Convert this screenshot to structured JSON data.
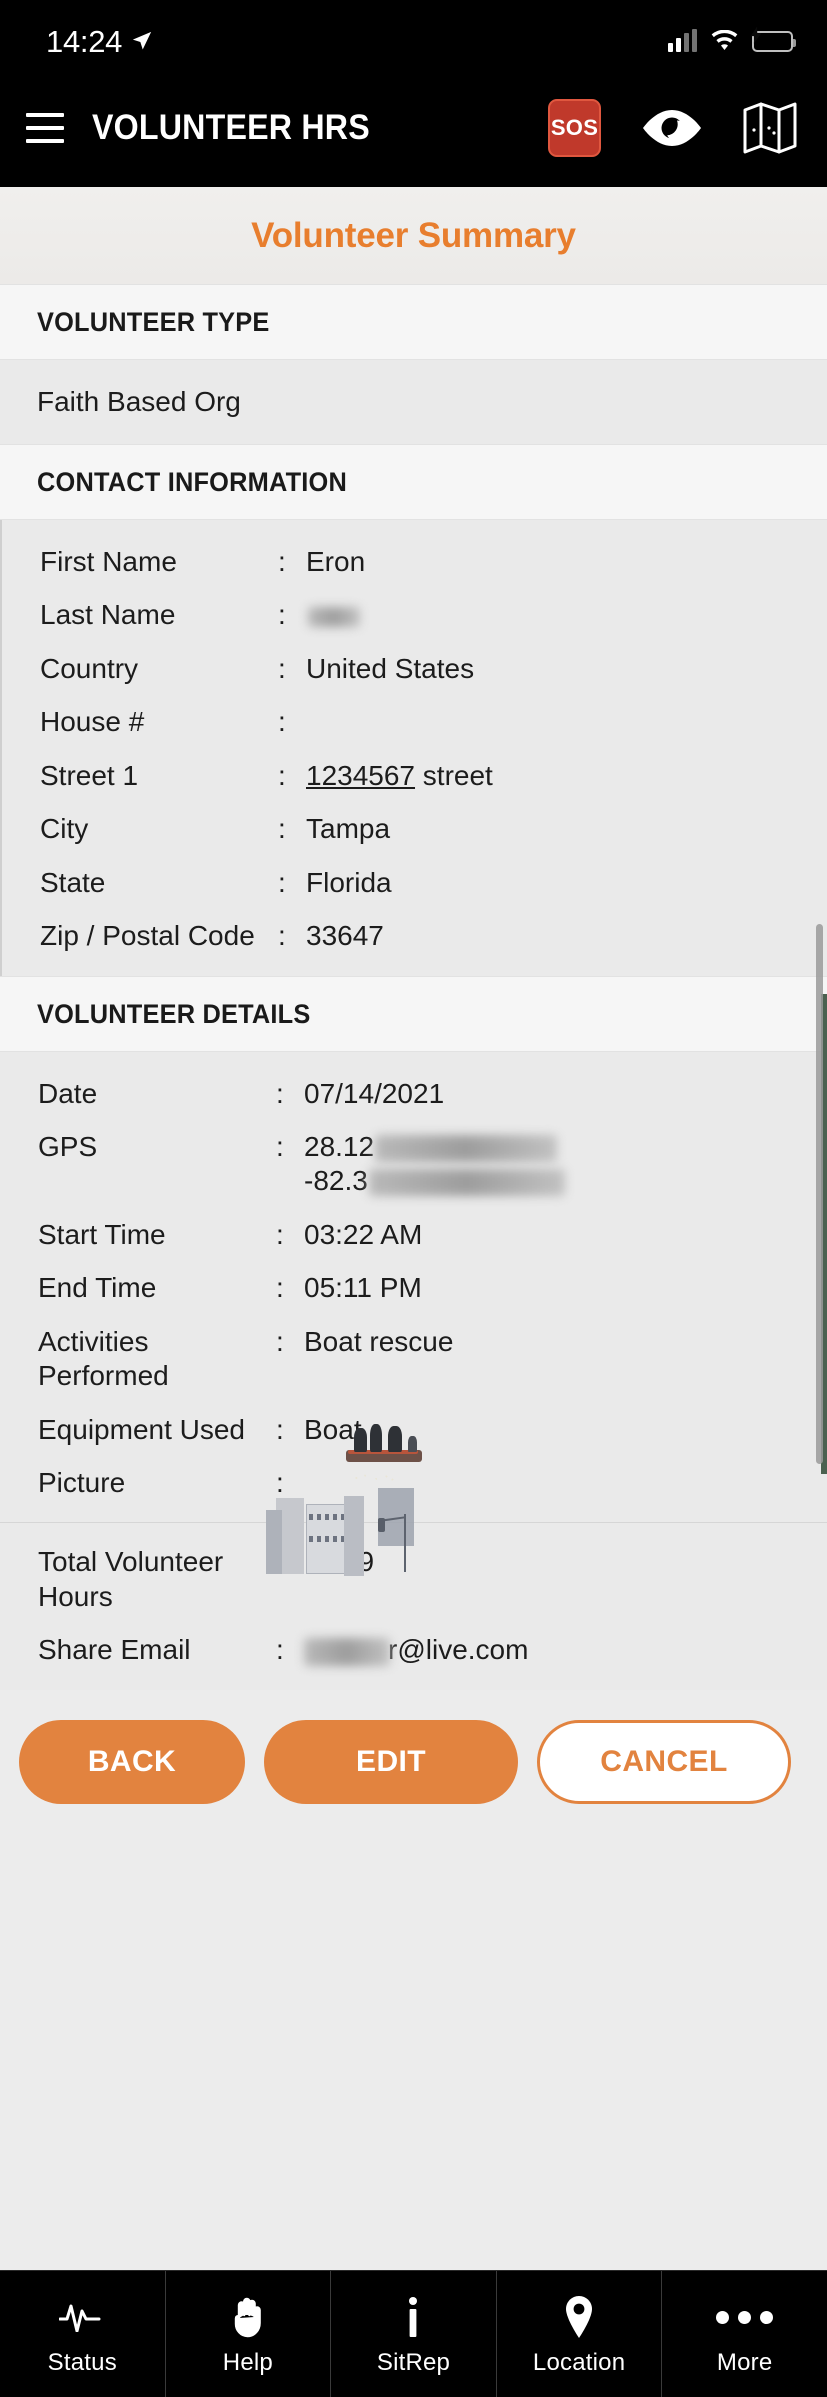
{
  "status_bar": {
    "time": "14:24",
    "location_icon": "location-arrow-icon",
    "signal_icon": "cellular-signal-icon",
    "wifi_icon": "wifi-icon",
    "battery_icon": "battery-charging-icon"
  },
  "app_bar": {
    "menu_icon": "hamburger-menu-icon",
    "title": "VOLUNTEER HRS",
    "sos_label": "SOS",
    "eye_icon": "eye-icon",
    "map_icon": "map-icon"
  },
  "page": {
    "title": "Volunteer Summary"
  },
  "sections": {
    "volunteer_type": {
      "heading": "VOLUNTEER TYPE",
      "value": "Faith Based Org"
    },
    "contact_information": {
      "heading": "CONTACT INFORMATION",
      "rows": [
        {
          "label": "First Name",
          "separator": ":",
          "value": "Eron"
        },
        {
          "label": "Last Name",
          "separator": ":",
          "value": "",
          "redacted": true
        },
        {
          "label": "Country",
          "separator": ":",
          "value": "United States"
        },
        {
          "label": "House #",
          "separator": ":",
          "value": ""
        },
        {
          "label": "Street 1",
          "separator": ":",
          "value": "1234567 street",
          "link_part": "1234567",
          "plain_part": " street"
        },
        {
          "label": "City",
          "separator": ":",
          "value": "Tampa"
        },
        {
          "label": "State",
          "separator": ":",
          "value": "Florida"
        },
        {
          "label": "Zip / Postal Code",
          "separator": ":",
          "value": "33647"
        }
      ]
    },
    "volunteer_details": {
      "heading": "VOLUNTEER DETAILS",
      "rows": [
        {
          "label": "Date",
          "separator": ":",
          "value": "07/14/2021"
        },
        {
          "label": "GPS",
          "separator": ":",
          "value_line1": "28.12",
          "value_line2": "-82.3",
          "redacted": true
        },
        {
          "label": "Start Time",
          "separator": ":",
          "value": "03:22 AM"
        },
        {
          "label": "End Time",
          "separator": ":",
          "value": "05:11 PM"
        },
        {
          "label": "Activities Performed",
          "separator": ":",
          "value": "Boat rescue"
        },
        {
          "label": "Equipment Used",
          "separator": ":",
          "value": "Boat"
        },
        {
          "label": "Picture",
          "separator": ":",
          "value": "",
          "image": "flooded-street-rescue-boat-photo"
        }
      ]
    },
    "summary": {
      "rows": [
        {
          "label": "Total Volunteer Hours",
          "separator": ":",
          "value": "13:49"
        },
        {
          "label": "Share Email",
          "separator": ":",
          "value": "r@live.com",
          "redacted": true
        }
      ]
    }
  },
  "actions": {
    "back_label": "BACK",
    "edit_label": "EDIT",
    "cancel_label": "CANCEL",
    "accent_color": "#e2833f"
  },
  "tab_bar": {
    "items": [
      {
        "label": "Status",
        "icon": "pulse-icon"
      },
      {
        "label": "Help",
        "icon": "hand-icon"
      },
      {
        "label": "SitRep",
        "icon": "info-icon"
      },
      {
        "label": "Location",
        "icon": "map-pin-icon"
      },
      {
        "label": "More",
        "icon": "ellipsis-icon"
      }
    ]
  }
}
